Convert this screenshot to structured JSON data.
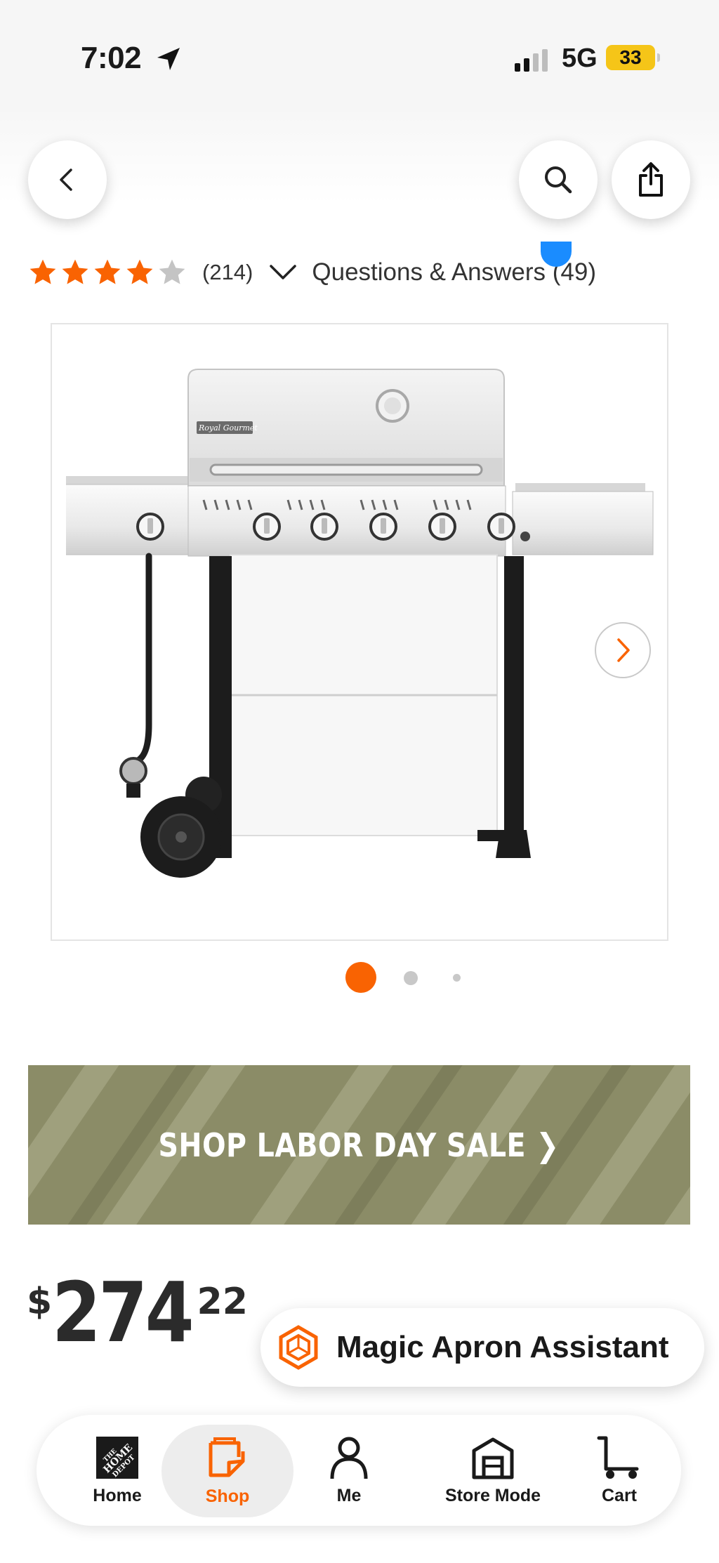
{
  "status_bar": {
    "time": "7:02",
    "network": "5G",
    "battery": "33"
  },
  "header": {
    "back_icon": "chevron-left-icon",
    "search_icon": "search-icon",
    "share_icon": "share-icon"
  },
  "rating": {
    "stars": 4,
    "max_stars": 5,
    "review_count": "(214)",
    "questions_label": "Questions & Answers (49)"
  },
  "gallery": {
    "brand_plate": "Royal Gourmet",
    "image_index": 1,
    "image_count": 3
  },
  "banner": {
    "text": "SHOP LABOR DAY SALE ❯"
  },
  "price": {
    "currency": "$",
    "dollars": "274",
    "cents": "22"
  },
  "assistant": {
    "label": "Magic Apron Assistant"
  },
  "bottom_nav": {
    "items": [
      {
        "label": "Home",
        "icon": "home-depot-logo-icon"
      },
      {
        "label": "Shop",
        "icon": "shop-icon",
        "active": true
      },
      {
        "label": "Me",
        "icon": "person-icon"
      },
      {
        "label": "Store Mode",
        "icon": "store-icon"
      },
      {
        "label": "Cart",
        "icon": "cart-icon"
      }
    ]
  },
  "colors": {
    "accent": "#f96302",
    "banner_bg": "#8b8c67",
    "star_empty": "#c4c4c4",
    "notification_dot": "#1a8cff"
  }
}
